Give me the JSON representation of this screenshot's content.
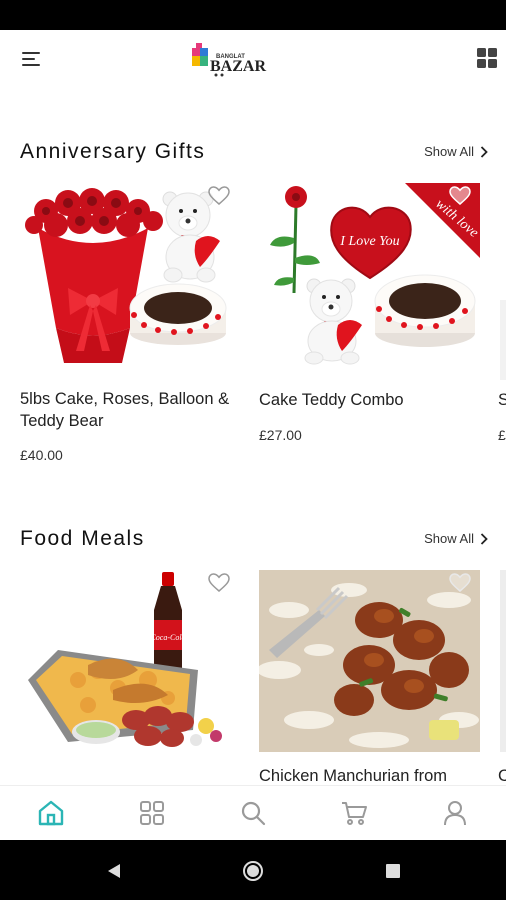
{
  "app": {
    "logo_text": "BANGLAT BAZAR"
  },
  "sections": [
    {
      "title": "Anniversary Gifts",
      "show_all": "Show All",
      "products": [
        {
          "name": "5lbs Cake, Roses, Balloon & Teddy Bear",
          "price": "£40.00"
        },
        {
          "name": "Cake Teddy Combo",
          "price": "£27.00"
        },
        {
          "name": "S",
          "price": "£"
        }
      ]
    },
    {
      "title": "Food Meals",
      "show_all": "Show All",
      "products": [
        {
          "name": "",
          "price": ""
        },
        {
          "name": "Chicken Manchurian from",
          "price": ""
        },
        {
          "name": "C",
          "price": ""
        }
      ]
    }
  ],
  "balloon_text": "I Love You",
  "ribbon_text": "with love",
  "bottom_nav": [
    "home-icon",
    "categories-icon",
    "search-icon",
    "cart-icon",
    "profile-icon"
  ],
  "colors": {
    "accent": "#2bb5b5",
    "nav_inactive": "#9a9a9a"
  }
}
